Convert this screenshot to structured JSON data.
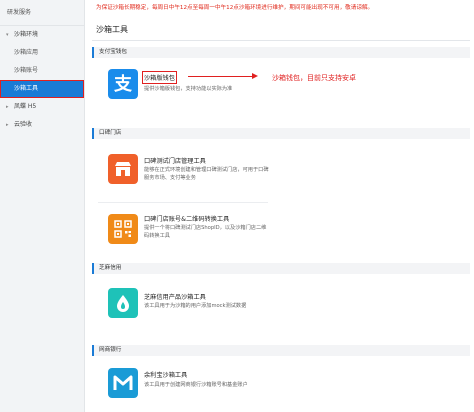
{
  "sidebar": {
    "title": "研发服务",
    "groups": [
      {
        "label": "沙箱环境",
        "items": [
          "沙箱应用",
          "沙箱账号",
          "沙箱工具"
        ]
      },
      {
        "label": "凤蝶 H5",
        "items": []
      },
      {
        "label": "云验收",
        "items": []
      }
    ],
    "active_item": "沙箱工具"
  },
  "notice": "为保证沙箱长期稳定，每周日中午12点至每周一中午12点沙箱环境进行维护，期间可能出现不可用，敬请谅解。",
  "page_title": "沙箱工具",
  "sections": [
    {
      "title": "支付宝钱包",
      "tools": [
        {
          "name": "沙箱版钱包",
          "desc": "提供沙箱版钱包，支持功能以实际为准",
          "icon": "alipay-icon",
          "color": "#1a8ceb"
        }
      ]
    },
    {
      "title": "口碑门店",
      "tools": [
        {
          "name": "口碑测试门店管理工具",
          "desc": "能够在正式环境创建和管理口碑测试门店，可用于口碑服务市场、支付等业务",
          "icon": "store-icon",
          "color": "#f0602a"
        },
        {
          "name": "口碑门店账号&二维码转换工具",
          "desc": "提供一个将口碑测试门店ShopID，以及沙箱门店二维码转换工具",
          "icon": "qrcode-icon",
          "color": "#f08a18"
        }
      ]
    },
    {
      "title": "芝麻信用",
      "tools": [
        {
          "name": "芝麻信用产品沙箱工具",
          "desc": "该工具用于为沙箱的用户添加mock测试数据",
          "icon": "sesame-icon",
          "color": "#1ec2b8"
        }
      ]
    },
    {
      "title": "网商银行",
      "tools": [
        {
          "name": "余利宝沙箱工具",
          "desc": "该工具用于创建网商银行沙箱账号和基金账户",
          "icon": "mybank-icon",
          "color": "#1a9bd6"
        }
      ]
    }
  ],
  "annotation": "沙箱钱包，目前只支持安卓",
  "colors": {
    "accent": "#1a7bd6",
    "annotation": "#e02020",
    "sidebar_bg": "#f2f4f6"
  }
}
